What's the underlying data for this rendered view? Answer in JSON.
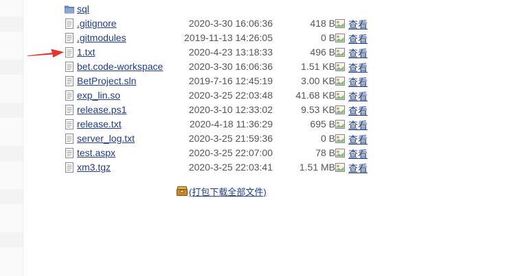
{
  "files": [
    {
      "name": "sql",
      "type": "folder"
    },
    {
      "name": ".gitignore",
      "type": "file",
      "date": "2020-3-30 16:06:36",
      "size": "418 B",
      "view": "查看"
    },
    {
      "name": ".gitmodules",
      "type": "file",
      "date": "2019-11-13 14:26:05",
      "size": "0 B",
      "view": "查看"
    },
    {
      "name": "1.txt",
      "type": "file",
      "date": "2020-4-23 13:18:33",
      "size": "496 B",
      "view": "查看"
    },
    {
      "name": "bet.code-workspace",
      "type": "file",
      "date": "2020-3-30 16:06:36",
      "size": "1.51 KB",
      "view": "查看"
    },
    {
      "name": "BetProject.sln",
      "type": "file",
      "date": "2019-7-16 12:45:19",
      "size": "3.00 KB",
      "view": "查看"
    },
    {
      "name": "exp_lin.so",
      "type": "file",
      "date": "2020-3-25 22:03:48",
      "size": "41.68 KB",
      "view": "查看"
    },
    {
      "name": "release.ps1",
      "type": "file",
      "date": "2020-3-10 12:33:02",
      "size": "9.53 KB",
      "view": "查看"
    },
    {
      "name": "release.txt",
      "type": "file",
      "date": "2020-4-18 11:36:29",
      "size": "695 B",
      "view": "查看"
    },
    {
      "name": "server_log.txt",
      "type": "file",
      "date": "2020-3-25 21:59:36",
      "size": "0 B",
      "view": "查看"
    },
    {
      "name": "test.aspx",
      "type": "file",
      "date": "2020-3-25 22:07:00",
      "size": "78 B",
      "view": "查看"
    },
    {
      "name": "xm3.tgz",
      "type": "file",
      "date": "2020-3-25 22:03:41",
      "size": "1.51 MB",
      "view": "查看"
    }
  ],
  "download_all": {
    "label": "(打包下载全部文件)",
    "icon": "package-icon"
  },
  "annotation": {
    "icon": "red-arrow-icon",
    "color": "#e8332a"
  },
  "colors": {
    "link": "#1f3c88",
    "folder": "#6f8fbf",
    "muted": "#555555"
  }
}
